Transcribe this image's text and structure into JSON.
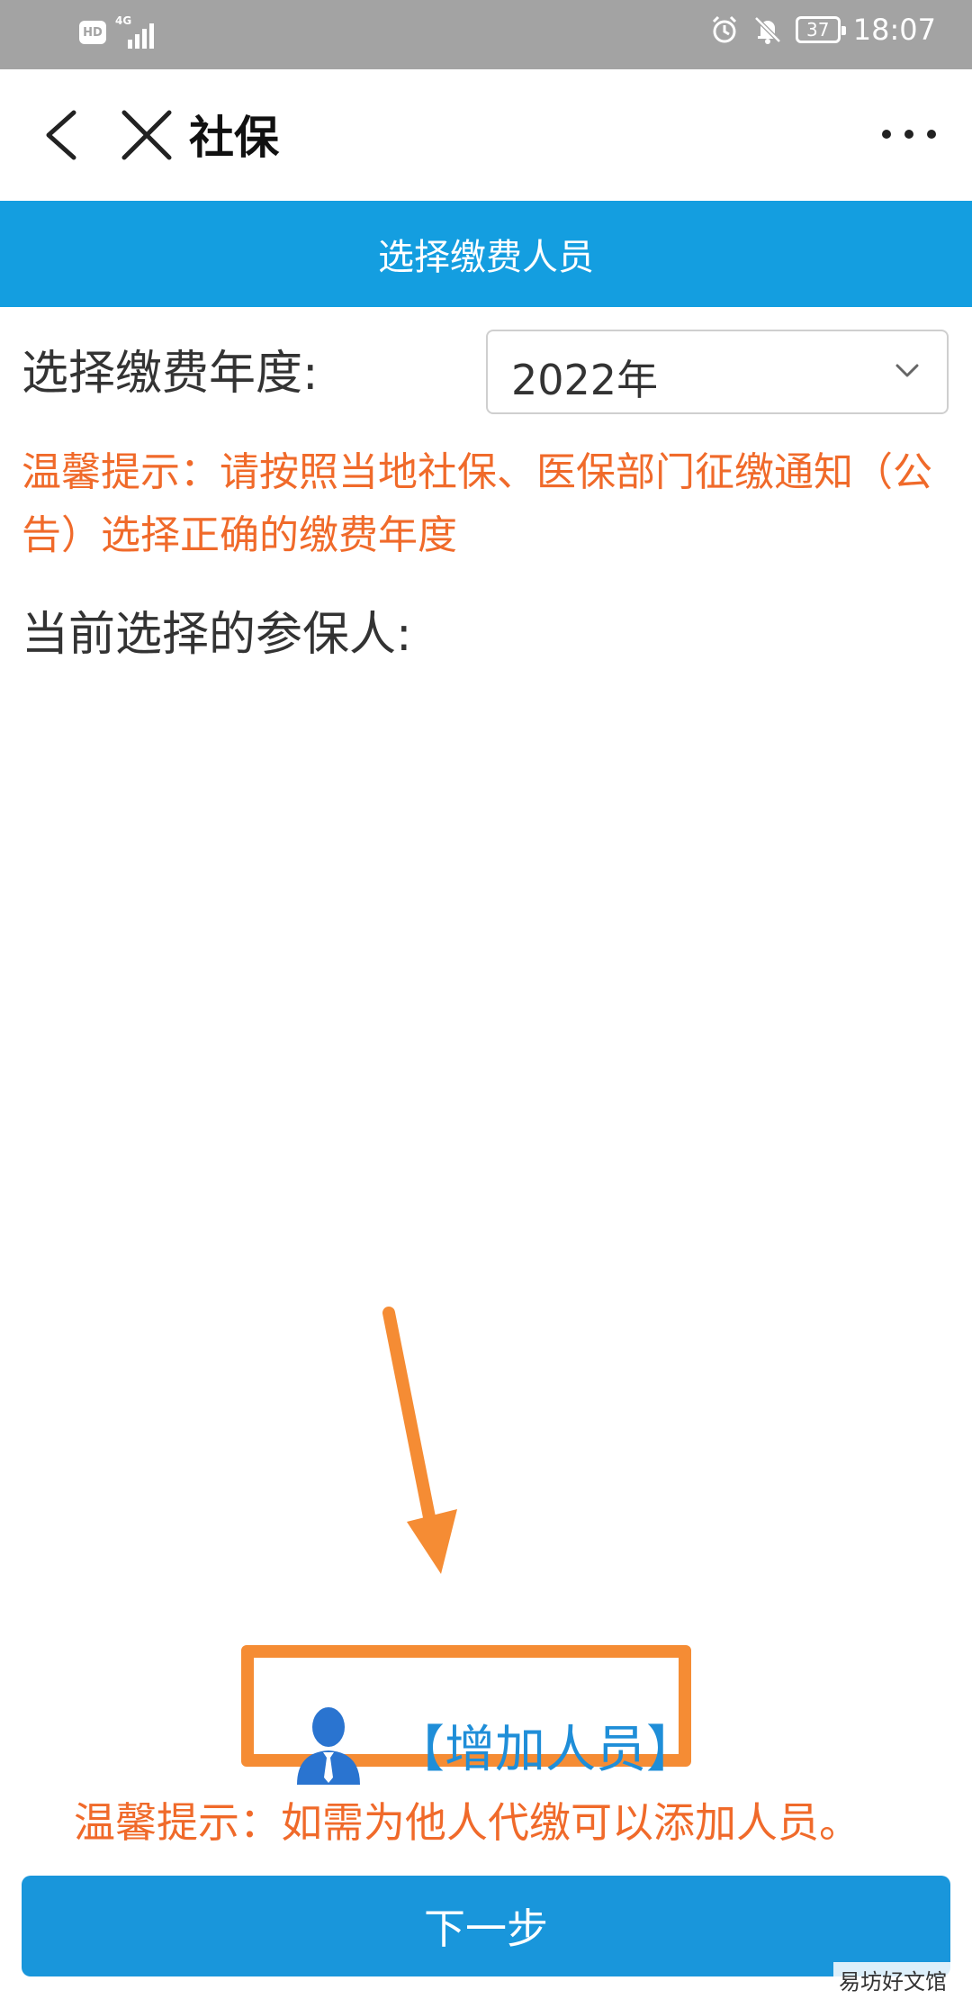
{
  "status_bar": {
    "hd": "HD",
    "network": "4G",
    "battery": "37",
    "time": "18:07"
  },
  "nav": {
    "title": "社保"
  },
  "header": {
    "title": "选择缴费人员"
  },
  "year": {
    "label": "选择缴费年度:",
    "value": "2022年"
  },
  "hint_year": "温馨提示：请按照当地社保、医保部门征缴通知（公告）选择正确的缴费年度",
  "selected": {
    "label": "当前选择的参保人:"
  },
  "add_person": {
    "label": "【增加人员】"
  },
  "hint_add": "温馨提示：如需为他人代缴可以添加人员。",
  "next_button": "下一步",
  "watermark": "易坊好文馆",
  "colors": {
    "header_blue": "#149ee0",
    "button_blue": "#1996db",
    "hint_orange": "#f06a2a",
    "annotation_orange": "#f58c34",
    "status_gray": "#a3a3a3"
  }
}
